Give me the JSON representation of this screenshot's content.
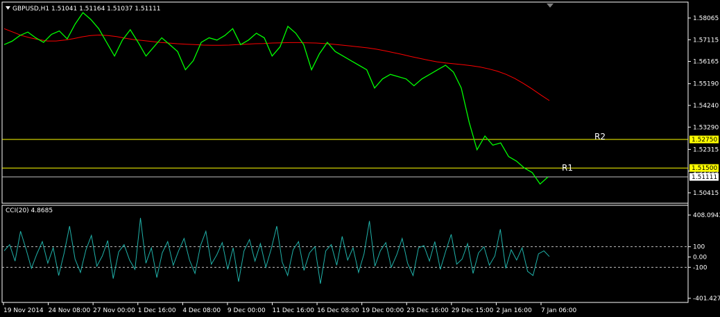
{
  "chart_header": {
    "symbol_line": "GBPUSD,H1  1.51041 1.51164 1.51037 1.51111",
    "menu_icon": "triangle-down-icon"
  },
  "colors": {
    "background": "#000000",
    "frame": "#ffffff",
    "price": "#00ff00",
    "ma": "#ff0000",
    "level": "#ffff00",
    "cci": "#20b2aa",
    "label_tag_yellow": "#ffff00",
    "label_tag_white": "#ffffff"
  },
  "chart_data": [
    {
      "type": "line",
      "title": "GBPUSD,H1",
      "y_ticks": [
        "1.58065",
        "1.57115",
        "1.56165",
        "1.55190",
        "1.54240",
        "1.53290",
        "1.52315",
        "1.51365",
        "1.50415"
      ],
      "ylim": [
        1.5011,
        1.5855
      ],
      "x_ticks": [
        "19 Nov 2014",
        "24 Nov 08:00",
        "27 Nov 00:00",
        "1 Dec 16:00",
        "4 Dec 08:00",
        "9 Dec 00:00",
        "11 Dec 16:00",
        "16 Dec 08:00",
        "19 Dec 00:00",
        "23 Dec 16:00",
        "29 Dec 15:00",
        "2 Jan 16:00",
        "7 Jan 06:00"
      ],
      "series": [
        {
          "name": "",
          "color": "#00ff00",
          "values": [
            1.569,
            1.5705,
            1.573,
            1.5745,
            1.572,
            1.57,
            1.5735,
            1.575,
            1.5715,
            1.578,
            1.583,
            1.58,
            1.576,
            1.57,
            1.564,
            1.571,
            1.5755,
            1.57,
            1.564,
            1.568,
            1.572,
            1.569,
            1.566,
            1.558,
            1.562,
            1.57,
            1.572,
            1.571,
            1.573,
            1.576,
            1.569,
            1.571,
            1.574,
            1.572,
            1.564,
            1.568,
            1.577,
            1.574,
            1.569,
            1.558,
            1.565,
            1.57,
            1.566,
            1.564,
            1.562,
            1.56,
            1.558,
            1.55,
            1.554,
            1.556,
            1.555,
            1.554,
            1.551,
            1.554,
            1.556,
            1.558,
            1.56,
            1.557,
            1.55,
            1.535,
            1.523,
            1.529,
            1.525,
            1.526,
            1.52,
            1.518,
            1.515,
            1.513,
            1.508,
            1.5111
          ]
        },
        {
          "name": "",
          "color": "#ff0000",
          "values": [
            1.576,
            1.5745,
            1.573,
            1.572,
            1.5712,
            1.5706,
            1.5706,
            1.571,
            1.5716,
            1.5724,
            1.573,
            1.5732,
            1.573,
            1.5725,
            1.5718,
            1.5712,
            1.5708,
            1.5704,
            1.57,
            1.5697,
            1.5694,
            1.5692,
            1.569,
            1.5688,
            1.5687,
            1.5687,
            1.5688,
            1.569,
            1.5692,
            1.5694,
            1.5695,
            1.5697,
            1.5698,
            1.5699,
            1.5699,
            1.5698,
            1.5697,
            1.5695,
            1.5692,
            1.5688,
            1.5684,
            1.568,
            1.5676,
            1.567,
            1.5663,
            1.5655,
            1.5647,
            1.5638,
            1.563,
            1.5622,
            1.5615,
            1.561,
            1.5606,
            1.5602,
            1.5598,
            1.5592,
            1.5584,
            1.5574,
            1.556,
            1.5542,
            1.552,
            1.5496,
            1.547,
            1.5445
          ]
        }
      ],
      "levels": [
        {
          "name": "R2",
          "value": 1.5275,
          "tag": "1.52750",
          "color": "#ffff00"
        },
        {
          "name": "R1",
          "value": 1.515,
          "tag": "1.51500",
          "color": "#ffff00"
        }
      ],
      "current_price": {
        "value": 1.51111,
        "tag": "1.51111",
        "color": "#ffffff"
      }
    },
    {
      "type": "line",
      "title": "CCI(20) 4.8685",
      "y_ticks": [
        "408.0943",
        "100",
        "0.00",
        "-100",
        "-401.4278"
      ],
      "ylim": [
        -401.4278,
        408.0943
      ],
      "reference_lines": [
        100,
        -100
      ],
      "series": [
        {
          "name": "",
          "color": "#20b2aa",
          "values": [
            60,
            120,
            -40,
            250,
            80,
            -110,
            30,
            150,
            -60,
            90,
            -180,
            40,
            300,
            -20,
            -150,
            70,
            210,
            -90,
            10,
            160,
            -210,
            50,
            120,
            -30,
            -120,
            380,
            -60,
            90,
            -200,
            40,
            150,
            -80,
            60,
            180,
            -30,
            -160,
            110,
            250,
            -70,
            20,
            140,
            -120,
            90,
            -240,
            60,
            170,
            -40,
            130,
            -100,
            80,
            300,
            -50,
            -180,
            70,
            150,
            -130,
            40,
            100,
            -260,
            60,
            120,
            -80,
            200,
            -30,
            90,
            -150,
            30,
            350,
            -90,
            60,
            140,
            -100,
            20,
            180,
            -60,
            -180,
            90,
            110,
            -40,
            150,
            -120,
            60,
            220,
            -70,
            -20,
            130,
            -160,
            40,
            100,
            -80,
            10,
            270,
            -110,
            70,
            -30,
            90,
            -140,
            -180,
            30,
            60,
            5
          ]
        }
      ]
    }
  ],
  "labels": {
    "r2": "R2",
    "r1": "R1"
  }
}
